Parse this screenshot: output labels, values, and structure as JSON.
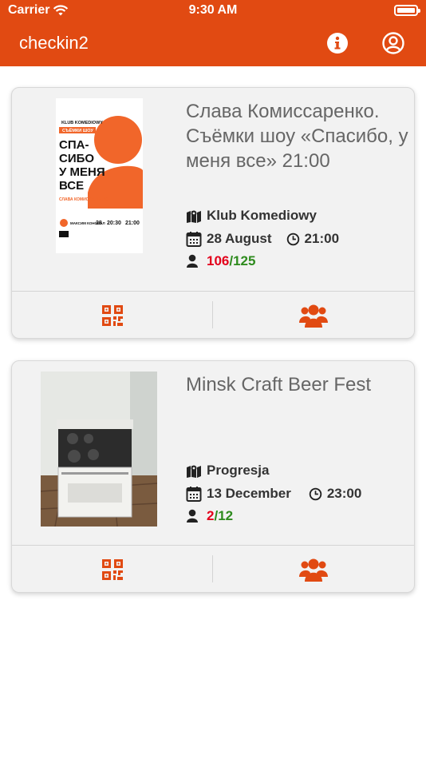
{
  "status_bar": {
    "carrier": "Carrier",
    "time": "9:30 AM"
  },
  "nav": {
    "title": "checkin2",
    "info_icon": "info-icon",
    "profile_icon": "user-circle-icon"
  },
  "colors": {
    "brand": "#e14a12",
    "checked": "#e3001b",
    "capacity": "#2e8b1e"
  },
  "events": [
    {
      "title": "Слава Комиссаренко. Съёмки шоу «Спасибо, у меня все» 21:00",
      "venue": "Klub Komediowy",
      "date": "28 August",
      "time": "21:00",
      "checked_in": "106",
      "capacity": "/125",
      "poster": {
        "brand": "KLUB KOMEDIOWY",
        "tag": "СЪЁМКИ ШОУ",
        "line1": "СПА-",
        "line2": "СИБО",
        "line3": "У МЕНЯ",
        "line4": "ВСЕ",
        "artist": "СЛАВА КОМИССАРЕНКО",
        "host": "МАКСИМ КОНОВАЛ",
        "day": "28",
        "time1": "20:30",
        "time2": "21:00"
      }
    },
    {
      "title": "Minsk Craft Beer Fest",
      "venue": "Progresja",
      "date": "13 December",
      "time": "23:00",
      "checked_in": "2",
      "capacity": "/12"
    }
  ],
  "actions": {
    "qr_icon": "qr-code-icon",
    "guests_icon": "users-icon"
  }
}
